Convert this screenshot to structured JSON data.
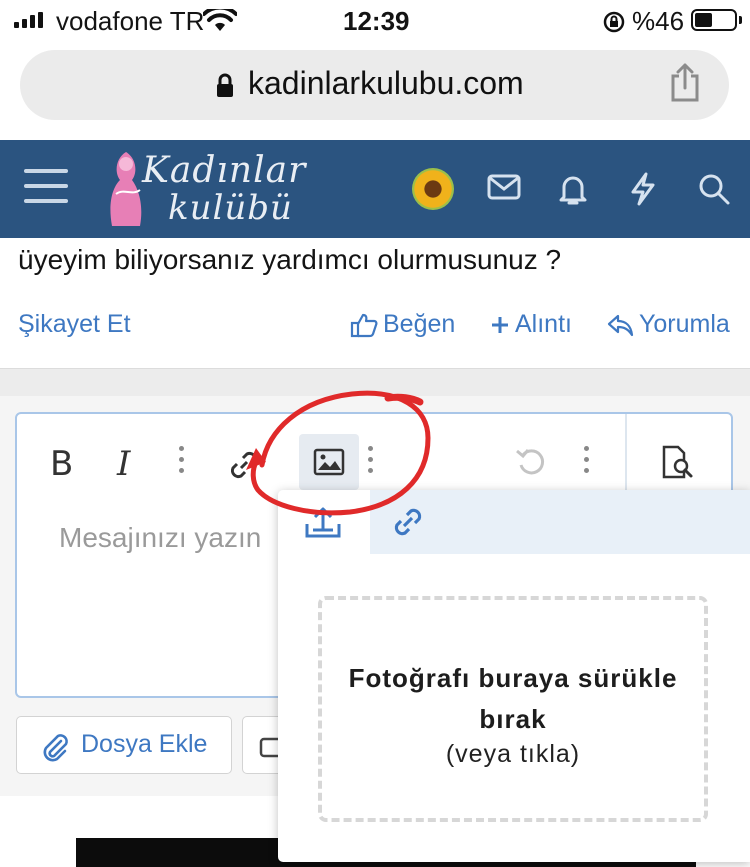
{
  "status_bar": {
    "carrier": "vodafone TR",
    "time": "12:39",
    "battery_percent": "%46",
    "battery_level": 0.46
  },
  "browser": {
    "url": "kadinlarkulubu.com",
    "share_icon": "share-icon"
  },
  "site_header": {
    "logo_line1": "Kadınlar",
    "logo_line2": "kulübü",
    "icons": [
      "menu-icon",
      "avatar",
      "mail-icon",
      "bell-icon",
      "bolt-icon",
      "search-icon"
    ]
  },
  "post": {
    "text_tail": "üyeyim biliyorsanız yardımcı olurmusunuz ?",
    "actions": {
      "report": "Şikayet Et",
      "like": "Beğen",
      "quote": "Alıntı",
      "reply": "Yorumla"
    }
  },
  "editor": {
    "toolbar": {
      "bold": "B",
      "italic": "I"
    },
    "placeholder": "Mesajınızı yazın"
  },
  "attachments": {
    "add_file": "Dosya Ekle"
  },
  "image_popup": {
    "tabs": [
      "upload-icon",
      "link-icon"
    ],
    "drop_title": "Fotoğrafı buraya sürükle bırak",
    "drop_subtitle": "(veya tıkla)"
  },
  "colors": {
    "header_bg": "#2b5480",
    "link": "#3e78c2",
    "annotation": "#e02a2a"
  }
}
